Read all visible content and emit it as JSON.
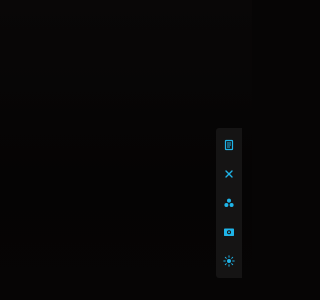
{
  "colors": {
    "background": "#060505",
    "toolbar": "#151414",
    "accent": "#1fb4e8"
  },
  "toolbar": {
    "buttons": [
      {
        "icon": "document-icon"
      },
      {
        "icon": "close-icon"
      },
      {
        "icon": "three-dots-cluster-icon"
      },
      {
        "icon": "screen-capture-icon"
      },
      {
        "icon": "sun-settings-icon"
      }
    ]
  }
}
